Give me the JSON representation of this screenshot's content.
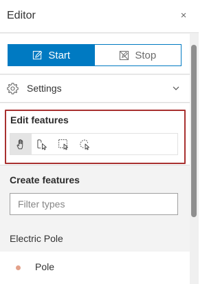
{
  "header": {
    "title": "Editor",
    "close_glyph": "×"
  },
  "workflow": {
    "start_label": "Start",
    "stop_label": "Stop",
    "active": "start",
    "start_icon": "pencil-square-icon",
    "stop_icon": "stop-edit-icon"
  },
  "settings": {
    "label": "Settings",
    "icon": "gear-icon",
    "chevron": "chevron-down-icon"
  },
  "edit_features": {
    "title": "Edit features",
    "tools": [
      {
        "name": "pan-hand-tool",
        "icon": "hand-icon",
        "selected": true
      },
      {
        "name": "select-tool",
        "icon": "cursor-select-icon",
        "selected": false
      },
      {
        "name": "rectangle-select-tool",
        "icon": "rectangle-select-icon",
        "selected": false
      },
      {
        "name": "lasso-select-tool",
        "icon": "lasso-select-icon",
        "selected": false
      }
    ]
  },
  "create_features": {
    "title": "Create features",
    "filter_placeholder": "Filter types",
    "filter_value": ""
  },
  "groups": [
    {
      "title": "Electric Pole",
      "items": [
        {
          "label": "Pole",
          "symbol_color": "#e3a18a"
        }
      ]
    }
  ],
  "colors": {
    "accent": "#007ac2",
    "highlight_border": "#a8302f",
    "panel_bg": "#f3f3f3"
  }
}
